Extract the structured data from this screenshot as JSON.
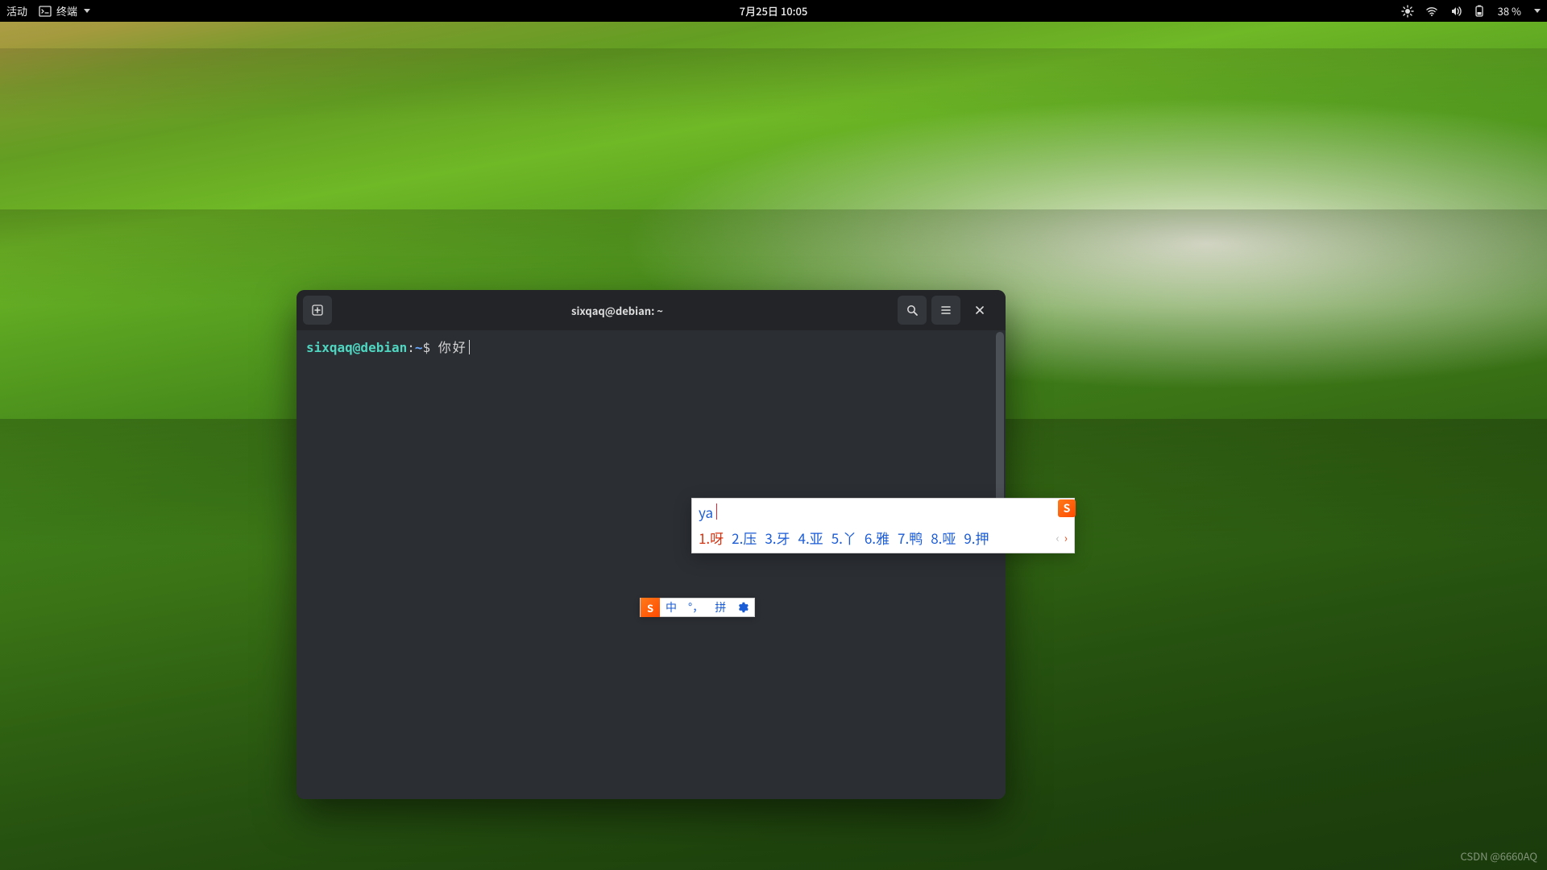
{
  "topbar": {
    "activities": "活动",
    "app_name": "终端",
    "datetime": "7月25日 10:05",
    "battery": "38 %"
  },
  "terminal": {
    "title": "sixqaq@debian: ~",
    "prompt_user": "sixqaq@debian",
    "prompt_sep": ":",
    "prompt_path": "~",
    "prompt_symbol": "$",
    "input_text": "你好"
  },
  "ime": {
    "input": "ya",
    "candidates": [
      {
        "n": "1",
        "ch": "呀"
      },
      {
        "n": "2",
        "ch": "压"
      },
      {
        "n": "3",
        "ch": "牙"
      },
      {
        "n": "4",
        "ch": "亚"
      },
      {
        "n": "5",
        "ch": "丫"
      },
      {
        "n": "6",
        "ch": "雅"
      },
      {
        "n": "7",
        "ch": "鸭"
      },
      {
        "n": "8",
        "ch": "哑"
      },
      {
        "n": "9",
        "ch": "押"
      }
    ],
    "logo_letter": "S",
    "status": {
      "lang": "中",
      "punct": "°，",
      "mode": "拼"
    }
  },
  "watermark": "CSDN @6660AQ"
}
